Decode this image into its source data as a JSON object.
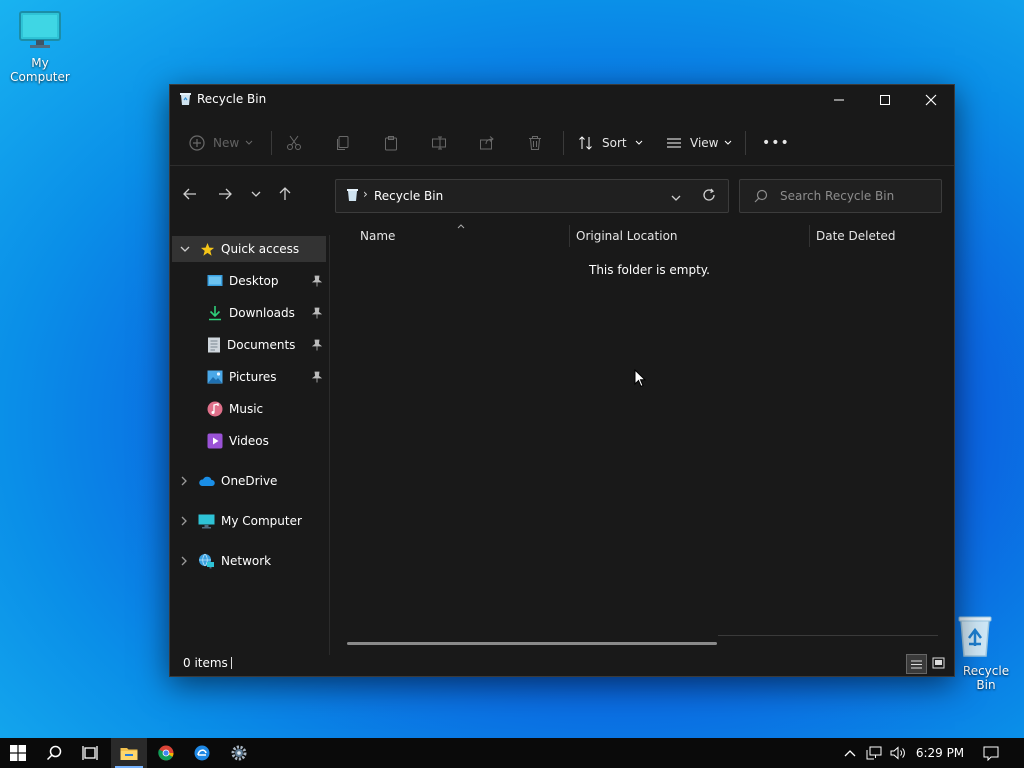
{
  "desktop": {
    "icons": [
      {
        "label": "My Computer"
      },
      {
        "label": "Recycle Bin"
      }
    ]
  },
  "window": {
    "title": "Recycle Bin",
    "toolbar": {
      "new_label": "New",
      "sort_label": "Sort",
      "view_label": "View",
      "more_label": "•••"
    },
    "address": {
      "crumb_sep": "›",
      "current": "Recycle Bin"
    },
    "search": {
      "placeholder": "Search Recycle Bin"
    },
    "sidebar": {
      "quick_access": "Quick access",
      "items": [
        {
          "label": "Desktop"
        },
        {
          "label": "Downloads"
        },
        {
          "label": "Documents"
        },
        {
          "label": "Pictures"
        },
        {
          "label": "Music"
        },
        {
          "label": "Videos"
        }
      ],
      "roots": [
        {
          "label": "OneDrive"
        },
        {
          "label": "My Computer"
        },
        {
          "label": "Network"
        }
      ]
    },
    "columns": [
      "Name",
      "Original Location",
      "Date Deleted"
    ],
    "empty_message": "This folder is empty.",
    "status": {
      "items_count": "0 items"
    }
  },
  "taskbar": {
    "clock": "6:29 PM"
  }
}
